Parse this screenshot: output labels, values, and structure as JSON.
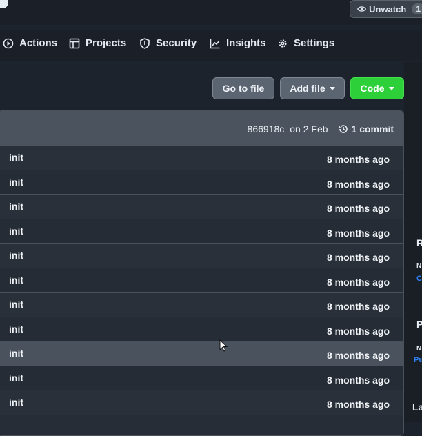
{
  "header": {
    "watch_label": "Unwatch",
    "watch_count": "1"
  },
  "nav": {
    "items": [
      {
        "label": "Actions",
        "icon": "play-icon"
      },
      {
        "label": "Projects",
        "icon": "table-icon"
      },
      {
        "label": "Security",
        "icon": "shield-icon"
      },
      {
        "label": "Insights",
        "icon": "graph-icon"
      },
      {
        "label": "Settings",
        "icon": "gear-icon"
      }
    ]
  },
  "toolbar": {
    "go_to_file": "Go to file",
    "add_file": "Add file",
    "code": "Code"
  },
  "commit": {
    "hash": "866918c",
    "date": "on 2 Feb",
    "count": "1 commit"
  },
  "files": [
    {
      "message": "init",
      "age": "8 months ago"
    },
    {
      "message": "init",
      "age": "8 months ago"
    },
    {
      "message": "init",
      "age": "8 months ago"
    },
    {
      "message": "init",
      "age": "8 months ago"
    },
    {
      "message": "init",
      "age": "8 months ago"
    },
    {
      "message": "init",
      "age": "8 months ago"
    },
    {
      "message": "init",
      "age": "8 months ago"
    },
    {
      "message": "init",
      "age": "8 months ago"
    },
    {
      "message": "init",
      "age": "8 months ago"
    },
    {
      "message": "init",
      "age": "8 months ago"
    },
    {
      "message": "init",
      "age": "8 months ago"
    }
  ],
  "sidebar_fragments": {
    "r": "R",
    "n1": "N",
    "c": "C",
    "p": "P",
    "n2": "N",
    "pu": "Pu",
    "l": "La"
  },
  "colors": {
    "accent_green": "#2ed03a",
    "link_blue": "#2f81f7",
    "background": "#1d232c"
  }
}
